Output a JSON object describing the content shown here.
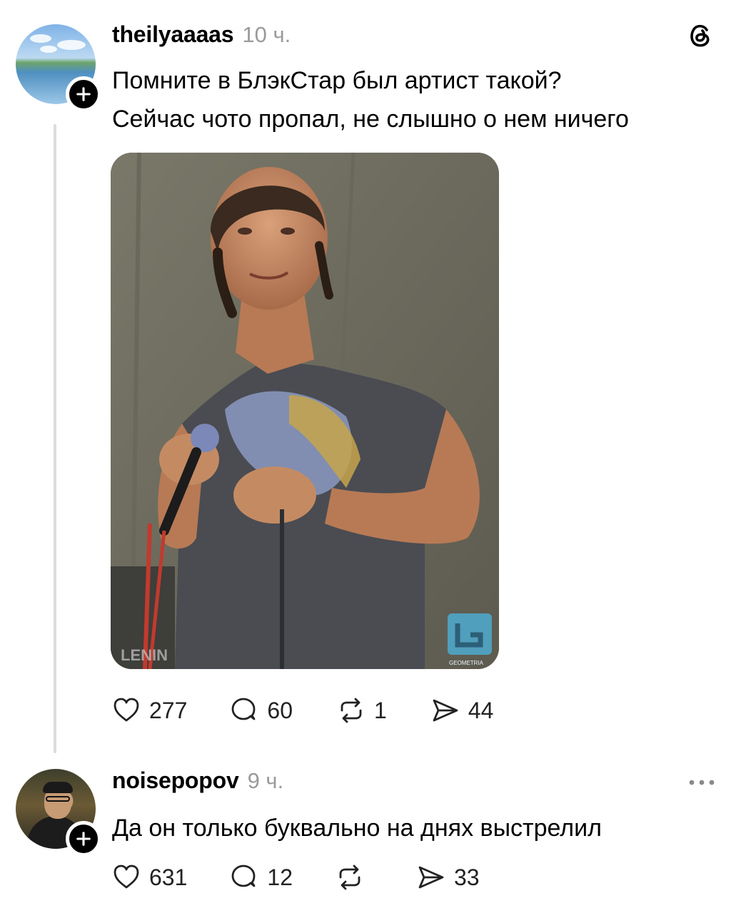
{
  "posts": [
    {
      "username": "theilyaaaas",
      "time": "10 ч.",
      "text_line1": "Помните в БлэкСтар был артист такой?",
      "text_line2": "Сейчас чото пропал, не слышно о нем ничего",
      "image": {
        "watermark_bottom_left": "LENIN",
        "watermark_bottom_right_logo": "G",
        "watermark_bottom_right_text": "GEOMETRIA"
      },
      "stats": {
        "likes": "277",
        "comments": "60",
        "reposts": "1",
        "shares": "44"
      }
    },
    {
      "username": "noisepopov",
      "time": "9 ч.",
      "text": "Да он только буквально на днях выстрелил",
      "stats": {
        "likes": "631",
        "comments": "12",
        "reposts": "",
        "shares": "33"
      }
    }
  ],
  "icons": {
    "follow": "plus-icon",
    "app": "threads-logo-icon",
    "more": "more-icon",
    "like": "heart-icon",
    "comment": "comment-icon",
    "repost": "repost-icon",
    "share": "send-icon"
  }
}
